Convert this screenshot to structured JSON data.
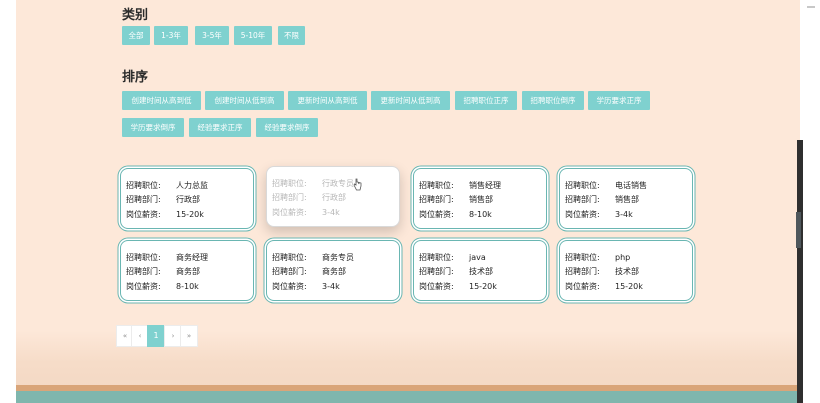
{
  "category": {
    "title": "类别",
    "buttons": [
      "全部",
      "1-3年",
      "3-5年",
      "5-10年",
      "不限"
    ]
  },
  "sort": {
    "title": "排序",
    "buttons": [
      "创建时间从高到低",
      "创建时间从低到高",
      "更新时间从高到低",
      "更新时间从低到高",
      "招聘职位正序",
      "招聘职位倒序",
      "学历要求正序",
      "学历要求倒序",
      "经验要求正序",
      "经验要求倒序"
    ]
  },
  "labels": {
    "position": "招聘职位:",
    "department": "招聘部门:",
    "salary": "岗位薪资:"
  },
  "jobs": [
    {
      "position": "人力总监",
      "department": "行政部",
      "salary": "15-20k"
    },
    {
      "position": "行政专员",
      "department": "行政部",
      "salary": "3-4k"
    },
    {
      "position": "销售经理",
      "department": "销售部",
      "salary": "8-10k"
    },
    {
      "position": "电话销售",
      "department": "销售部",
      "salary": "3-4k"
    },
    {
      "position": "商务经理",
      "department": "商务部",
      "salary": "8-10k"
    },
    {
      "position": "商务专员",
      "department": "商务部",
      "salary": "3-4k"
    },
    {
      "position": "java",
      "department": "技术部",
      "salary": "15-20k"
    },
    {
      "position": "php",
      "department": "技术部",
      "salary": "15-20k"
    }
  ],
  "pagination": {
    "first": "«",
    "prev": "‹",
    "current": "1",
    "next": "›",
    "last": "»"
  },
  "colors": {
    "accent": "#7fd1cf",
    "background": "#fde8d9",
    "card_border": "#6ab6b2",
    "footer_orange": "#d9a579",
    "footer_teal": "#7fb6ad"
  }
}
